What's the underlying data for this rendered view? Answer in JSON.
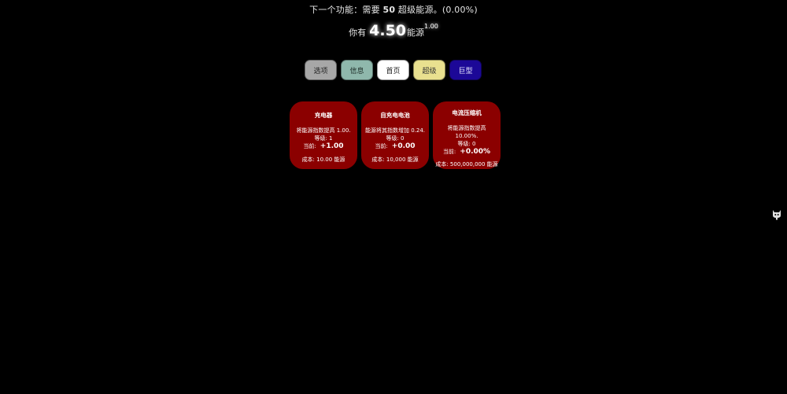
{
  "header": {
    "next_feature_prefix": "下一个功能：需要 ",
    "next_feature_num": "50",
    "next_feature_suffix": " 超级能源。(0.00%)",
    "energy_prefix": "你有",
    "energy_amount": "4.50",
    "energy_unit": "能源",
    "energy_exponent": "1.00"
  },
  "tabs": [
    {
      "label": "选项",
      "color": "#a7a7a7"
    },
    {
      "label": "信息",
      "color": "#8fb8ac"
    },
    {
      "label": "首页",
      "color": "#ffffff"
    },
    {
      "label": "超级",
      "color": "#e9e08f"
    },
    {
      "label": "巨型",
      "color": "#1c0897"
    }
  ],
  "upgrades": [
    {
      "title": "充电器",
      "description": "将能源指数提高 1.00.",
      "level": "等级: 1",
      "current_label": "当前:",
      "current_value": "+1.00",
      "cost": "成本: 10.00 能源"
    },
    {
      "title": "自充电电池",
      "description": "能源将其指数增加 0.24.",
      "level": "等级: 0",
      "current_label": "当前:",
      "current_value": "+0.00",
      "cost": "成本: 10,000 能源"
    },
    {
      "title": "电流压缩机",
      "description": "将能源指数提高 10.00%.",
      "level": "等级: 0",
      "current_label": "当前:",
      "current_value": "+0.00%",
      "cost": "成本: 500,000,000 能源"
    }
  ],
  "colors": {
    "background": "#000000",
    "card": "#8b0000"
  },
  "icons": {
    "side": "cat-icon"
  }
}
